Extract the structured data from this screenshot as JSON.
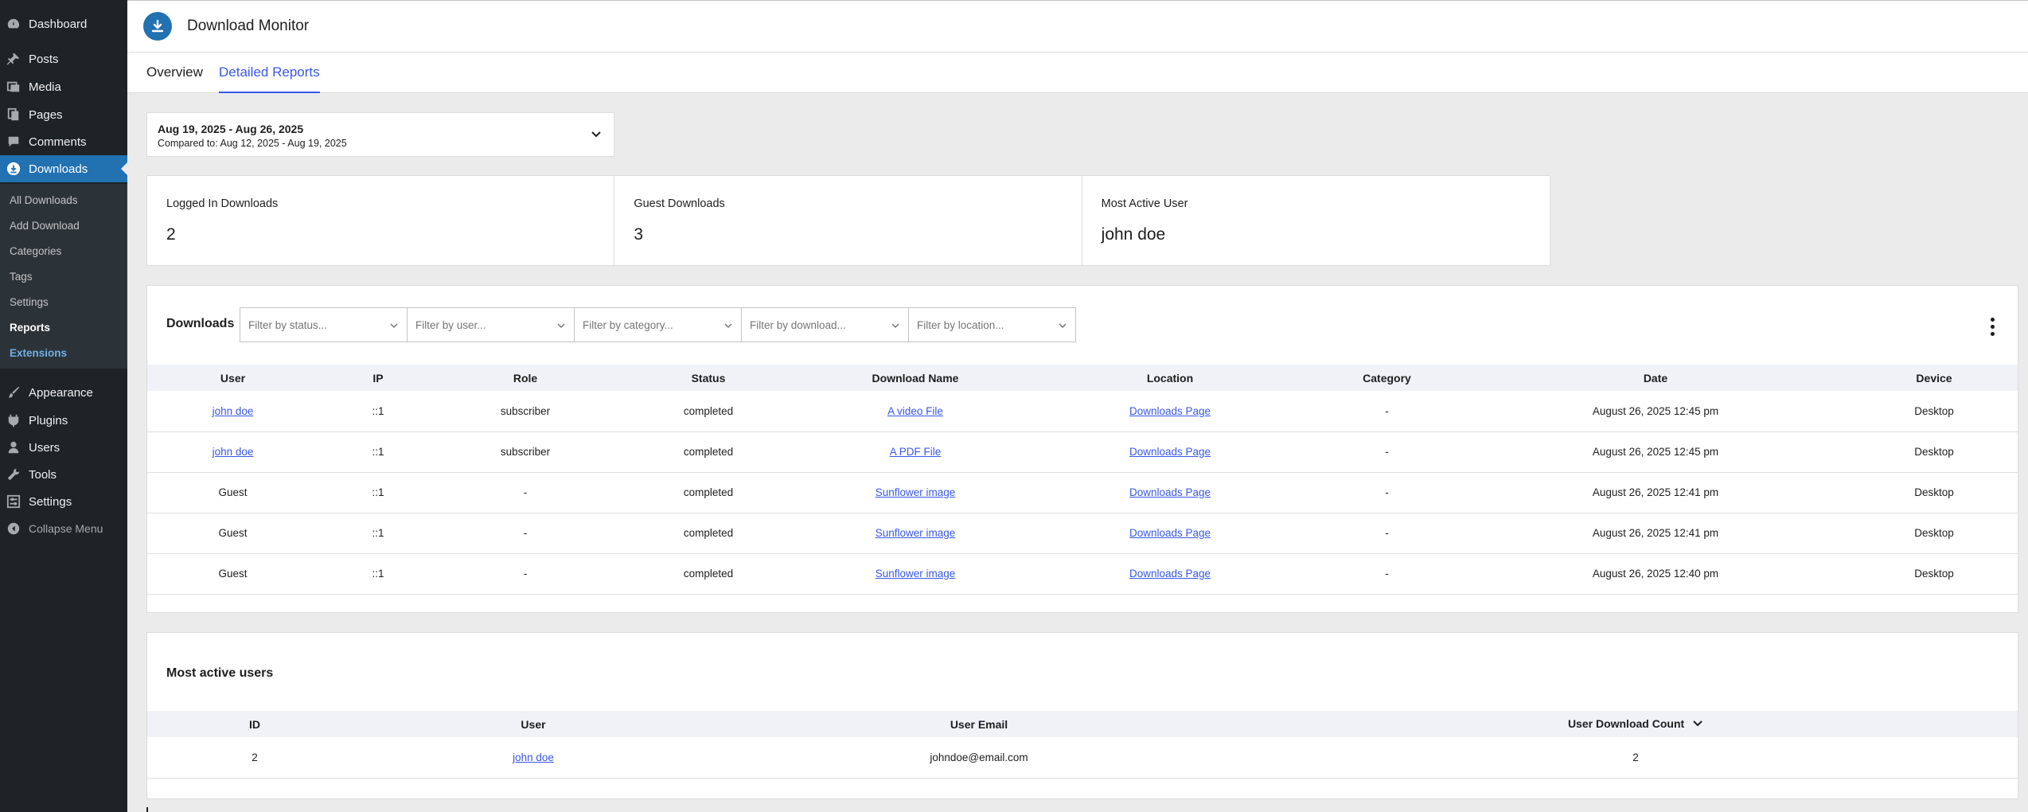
{
  "sidebar": {
    "items": [
      {
        "label": "Dashboard",
        "icon": "dashboard-icon"
      },
      {
        "label": "Posts",
        "icon": "pin-icon"
      },
      {
        "label": "Media",
        "icon": "media-icon"
      },
      {
        "label": "Pages",
        "icon": "pages-icon"
      },
      {
        "label": "Comments",
        "icon": "comment-icon"
      },
      {
        "label": "Downloads",
        "icon": "download-icon"
      },
      {
        "label": "Appearance",
        "icon": "brush-icon"
      },
      {
        "label": "Plugins",
        "icon": "plugin-icon"
      },
      {
        "label": "Users",
        "icon": "user-icon"
      },
      {
        "label": "Tools",
        "icon": "wrench-icon"
      },
      {
        "label": "Settings",
        "icon": "settings-icon"
      },
      {
        "label": "Collapse Menu",
        "icon": "collapse-icon"
      }
    ],
    "submenu": [
      "All Downloads",
      "Add Download",
      "Categories",
      "Tags",
      "Settings",
      "Reports",
      "Extensions"
    ]
  },
  "header": {
    "title": "Download Monitor"
  },
  "tabs": [
    "Overview",
    "Detailed Reports"
  ],
  "daterange": {
    "main": "Aug 19, 2025 - Aug 26, 2025",
    "compare": "Compared to: Aug 12, 2025 - Aug 19, 2025"
  },
  "stats": [
    {
      "label": "Logged In Downloads",
      "value": "2"
    },
    {
      "label": "Guest Downloads",
      "value": "3"
    },
    {
      "label": "Most Active User",
      "value": "john doe"
    }
  ],
  "downloads": {
    "title": "Downloads",
    "filters": [
      "Filter by status...",
      "Filter by user...",
      "Filter by category...",
      "Filter by download...",
      "Filter by location..."
    ],
    "columns": [
      "User",
      "IP",
      "Role",
      "Status",
      "Download Name",
      "Location",
      "Category",
      "Date",
      "Device"
    ],
    "rows": [
      {
        "user": "john doe",
        "user_link": true,
        "ip": "::1",
        "role": "subscriber",
        "status": "completed",
        "download": "A video File",
        "location": "Downloads Page",
        "category": "-",
        "date": "August 26, 2025 12:45 pm",
        "device": "Desktop"
      },
      {
        "user": "john doe",
        "user_link": true,
        "ip": "::1",
        "role": "subscriber",
        "status": "completed",
        "download": "A PDF File",
        "location": "Downloads Page",
        "category": "-",
        "date": "August 26, 2025 12:45 pm",
        "device": "Desktop"
      },
      {
        "user": "Guest",
        "user_link": false,
        "ip": "::1",
        "role": "-",
        "status": "completed",
        "download": "Sunflower image",
        "location": "Downloads Page",
        "category": "-",
        "date": "August 26, 2025 12:41 pm",
        "device": "Desktop"
      },
      {
        "user": "Guest",
        "user_link": false,
        "ip": "::1",
        "role": "-",
        "status": "completed",
        "download": "Sunflower image",
        "location": "Downloads Page",
        "category": "-",
        "date": "August 26, 2025 12:41 pm",
        "device": "Desktop"
      },
      {
        "user": "Guest",
        "user_link": false,
        "ip": "::1",
        "role": "-",
        "status": "completed",
        "download": "Sunflower image",
        "location": "Downloads Page",
        "category": "-",
        "date": "August 26, 2025 12:40 pm",
        "device": "Desktop"
      }
    ]
  },
  "most_active": {
    "title": "Most active users",
    "columns": [
      "ID",
      "User",
      "User Email",
      "User Download Count"
    ],
    "rows": [
      {
        "id": "2",
        "user": "john doe",
        "email": "johndoe@email.com",
        "count": "2"
      }
    ]
  },
  "colors": {
    "sidebar_bg": "#1d2327",
    "active_blue": "#2271b1",
    "link_blue": "#3858e9"
  }
}
